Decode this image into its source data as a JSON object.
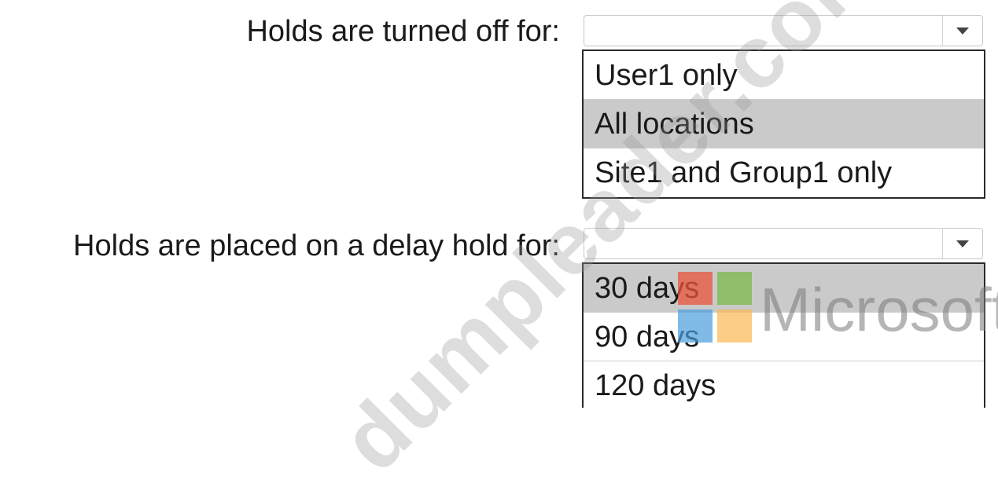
{
  "question1": {
    "label": "Holds are turned off for:",
    "selected_value": "",
    "options": [
      "User1 only",
      "All locations",
      "Site1 and Group1 only"
    ]
  },
  "question2": {
    "label": "Holds are placed on a delay hold for:",
    "selected_value": "",
    "options": [
      "30 days",
      "90 days",
      "120 days"
    ]
  },
  "watermark": {
    "text": "dumpleader.com",
    "brand": "Microsoft"
  },
  "colors": {
    "highlight": "#cacaca",
    "border": "#2b2b2b",
    "logo_red": "#e8543a",
    "logo_green": "#7aba4a",
    "logo_blue": "#4a9ede",
    "logo_yellow": "#fab850"
  },
  "icons": {
    "dropdown_arrow": "caret-down-icon"
  }
}
